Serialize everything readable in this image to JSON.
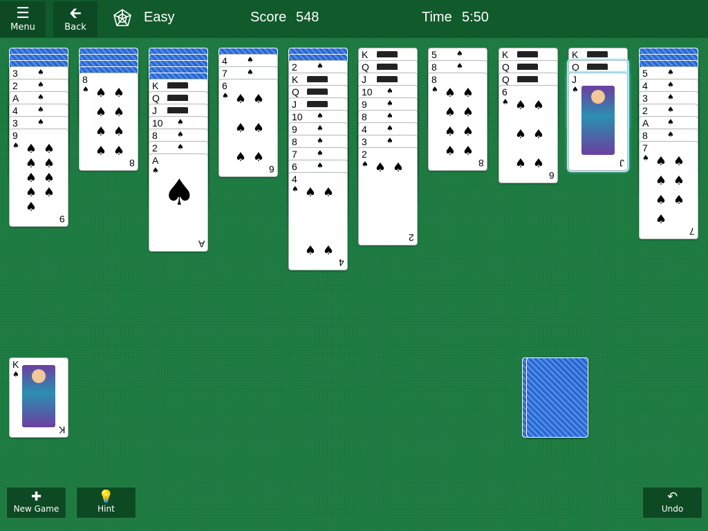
{
  "topbar": {
    "menu_label": "Menu",
    "back_label": "Back",
    "difficulty": "Easy",
    "score_label": "Score",
    "score_value": "548",
    "time_label": "Time",
    "time_value": "5:50"
  },
  "bottom": {
    "new_game_label": "New Game",
    "hint_label": "Hint",
    "undo_label": "Undo"
  },
  "colors": {
    "felt": "#1b7a3f",
    "bar": "#115a2c",
    "card_back": "#2f6fd6"
  },
  "tableau": [
    {
      "backs": 3,
      "cards": [
        "3",
        "2",
        "A",
        "4",
        "3",
        "9"
      ]
    },
    {
      "backs": 4,
      "cards": [
        "8"
      ]
    },
    {
      "backs": 5,
      "cards": [
        "K",
        "Q",
        "J",
        "10",
        "8",
        "2",
        "A"
      ]
    },
    {
      "backs": 1,
      "cards": [
        "4",
        "7",
        "6"
      ]
    },
    {
      "backs": 2,
      "cards": [
        "2",
        "K",
        "Q",
        "J",
        "10",
        "9",
        "8",
        "7",
        "6",
        "4"
      ]
    },
    {
      "backs": 0,
      "cards": [
        "K",
        "Q",
        "J",
        "10",
        "9",
        "8",
        "4",
        "3",
        "2"
      ]
    },
    {
      "backs": 0,
      "cards": [
        "5",
        "8",
        "8"
      ]
    },
    {
      "backs": 0,
      "cards": [
        "K",
        "Q",
        "Q",
        "6"
      ]
    },
    {
      "backs": 0,
      "cards": [
        "K",
        "Q",
        "J"
      ]
    },
    {
      "backs": 3,
      "cards": [
        "5",
        "4",
        "3",
        "2",
        "A",
        "8",
        "7"
      ]
    }
  ],
  "foundation": {
    "card": "K"
  },
  "stock": {
    "remaining_piles": 2
  }
}
